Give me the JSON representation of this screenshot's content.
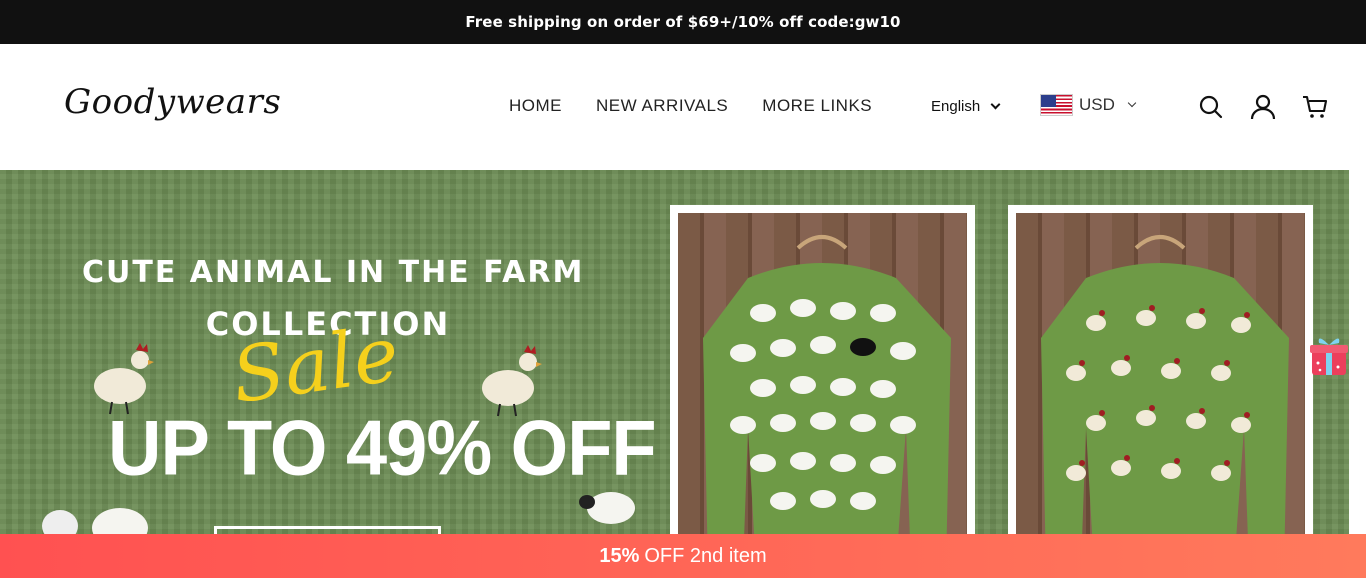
{
  "announcement": "Free shipping on order of $69+/10% off code:gw10",
  "header": {
    "logo": "Goodywears",
    "nav": [
      "HOME",
      "NEW ARRIVALS",
      "MORE LINKS"
    ],
    "language": "English",
    "currency": "USD"
  },
  "banner": {
    "line1": "CUTE ANIMAL IN THE FARM",
    "line2": "COLLECTION",
    "sale": "Sale",
    "offer": "UP TO 49% OFF"
  },
  "promo": {
    "highlight": "15%",
    "text": "OFF 2nd item"
  },
  "colors": {
    "announce_bg": "#111111",
    "banner_green": "#6c8c55",
    "sale_yellow": "#f5d01c",
    "promo_red": "#ff5151"
  }
}
